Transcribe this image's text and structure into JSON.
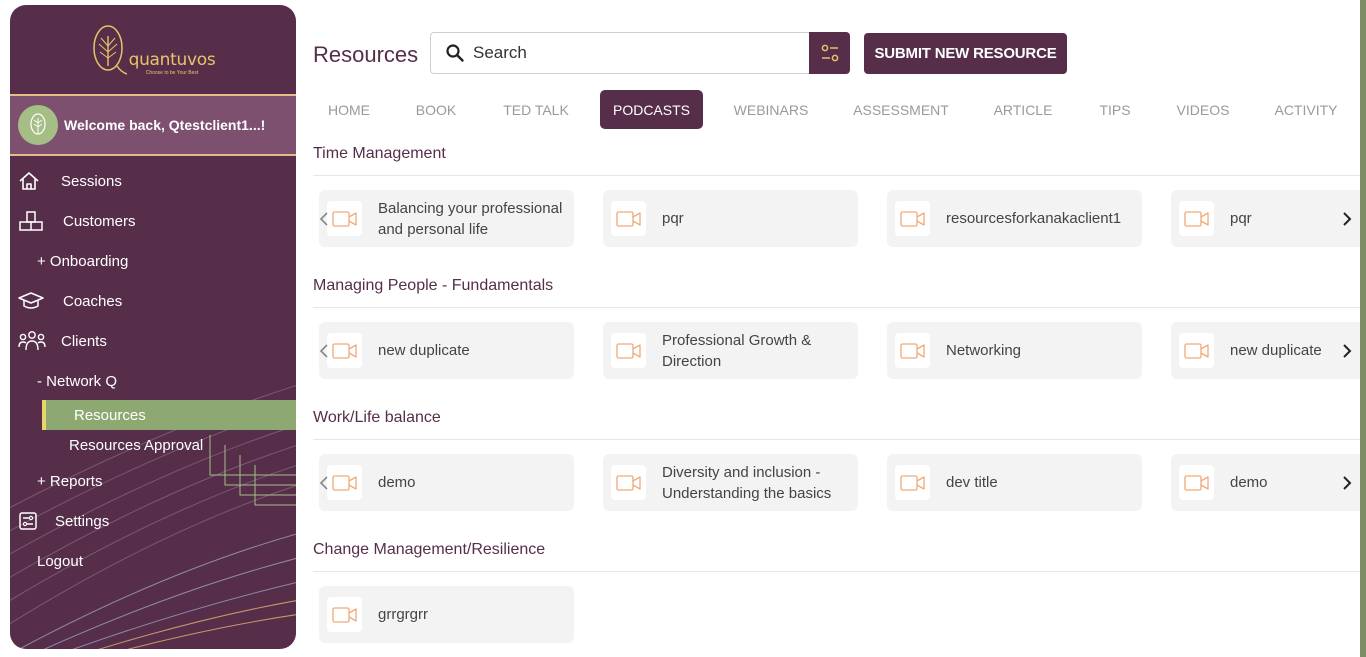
{
  "brand": {
    "name": "quantuvos",
    "tagline": "Choose to be Your Best"
  },
  "user": {
    "welcome": "Welcome back, Qtestclient1...!"
  },
  "sidebar": {
    "items": [
      {
        "label": "Sessions",
        "icon": "home-icon"
      },
      {
        "label": "Customers",
        "icon": "customers-icon"
      },
      {
        "label": "+ Onboarding"
      },
      {
        "label": "Coaches",
        "icon": "graduation-cap-icon"
      },
      {
        "label": "Clients",
        "icon": "clients-icon"
      },
      {
        "label": "- Network Q"
      },
      {
        "label": "Resources"
      },
      {
        "label": "Resources Approval"
      },
      {
        "label": "+ Reports"
      },
      {
        "label": "Settings",
        "icon": "settings-icon"
      },
      {
        "label": "Logout"
      }
    ]
  },
  "header": {
    "title": "Resources",
    "search_placeholder": "Search",
    "submit_label": "SUBMIT NEW RESOURCE"
  },
  "tabs": [
    {
      "label": "HOME"
    },
    {
      "label": "BOOK"
    },
    {
      "label": "TED TALK"
    },
    {
      "label": "PODCASTS",
      "active": true
    },
    {
      "label": "WEBINARS"
    },
    {
      "label": "ASSESSMENT"
    },
    {
      "label": "ARTICLE"
    },
    {
      "label": "TIPS"
    },
    {
      "label": "VIDEOS"
    },
    {
      "label": "ACTIVITY"
    }
  ],
  "sections": [
    {
      "title": "Time Management",
      "cards": [
        "Balancing your professional and personal life",
        "pqr",
        "resourcesforkanakaclient1",
        "pqr"
      ]
    },
    {
      "title": "Managing People - Fundamentals",
      "cards": [
        "new duplicate",
        "Professional Growth & Direction",
        "Networking",
        "new duplicate"
      ]
    },
    {
      "title": "Work/Life balance",
      "cards": [
        "demo",
        "Diversity and inclusion - Understanding the basics",
        "dev title",
        "demo"
      ]
    },
    {
      "title": "Change Management/Resilience",
      "cards": [
        "grrgrgrr"
      ]
    }
  ],
  "colors": {
    "brand_purple": "#562e4a",
    "active_green": "#8ea872",
    "accent_gold": "#e7c36b",
    "video_icon_orange": "#f0a977"
  }
}
